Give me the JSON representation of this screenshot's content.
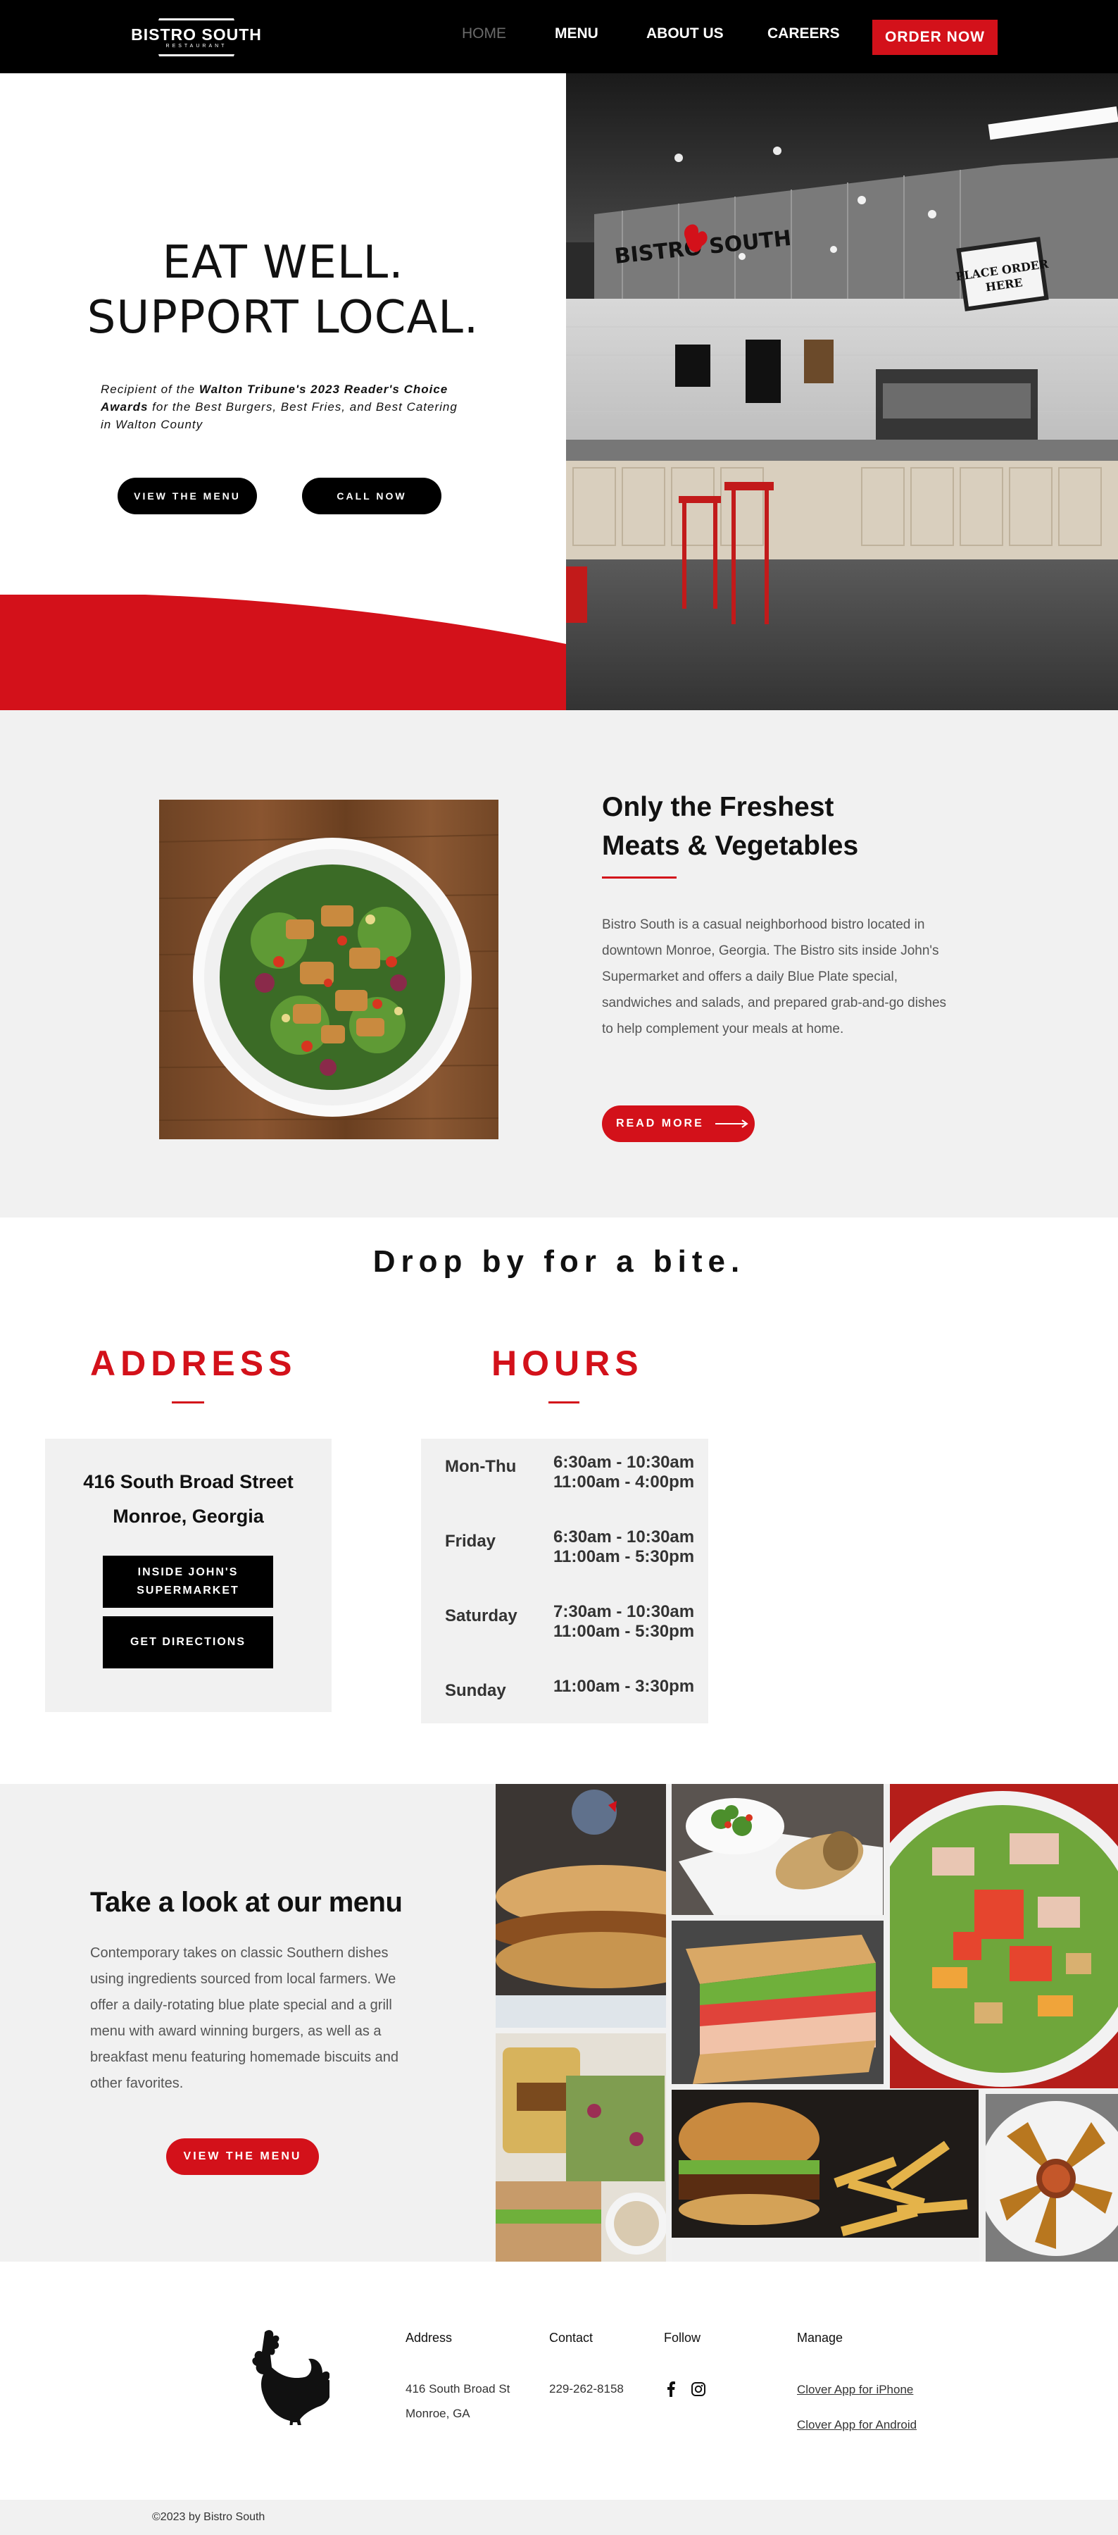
{
  "nav": {
    "logo_text": "BISTRO SOUTH",
    "logo_sub": "RESTAURANT",
    "links": [
      "HOME",
      "MENU",
      "ABOUT US",
      "CAREERS"
    ],
    "order_label": "ORDER NOW"
  },
  "hero": {
    "title_line1": "EAT WELL.",
    "title_line2": "SUPPORT LOCAL.",
    "award_prefix": "Recipient of the ",
    "award_bold": "Walton Tribune's 2023 Reader's Choice Awards",
    "award_suffix": " for the Best Burgers, Best Fries, and Best Catering in Walton County",
    "btn_menu": "VIEW THE MENU",
    "btn_call": "CALL NOW",
    "photo_sign_brand": "BISTRO SOUTH",
    "photo_sign_order": "PLACE ORDER HERE"
  },
  "fresh": {
    "title_line1": "Only the Freshest",
    "title_line2": "Meats & Vegetables",
    "body": "Bistro South is a casual neighborhood bistro located in downtown Monroe, Georgia. The Bistro sits inside John's Supermarket and offers a daily Blue Plate special, sandwiches and salads, and prepared grab-and-go dishes to help complement your meals at home.",
    "btn": "READ MORE"
  },
  "visit": {
    "title": "Drop by for a bite.",
    "address_head": "ADDRESS",
    "hours_head": "HOURS",
    "street": "416 South Broad Street",
    "city": "Monroe, Georgia",
    "btn_inside": "INSIDE JOHN'S SUPERMARKET",
    "btn_directions": "GET DIRECTIONS",
    "hours": [
      {
        "day": "Mon-Thu",
        "t1": "6:30am - 10:30am",
        "t2": "11:00am - 4:00pm"
      },
      {
        "day": "Friday",
        "t1": "6:30am - 10:30am",
        "t2": "11:00am - 5:30pm"
      },
      {
        "day": "Saturday",
        "t1": "7:30am - 10:30am",
        "t2": "11:00am - 5:30pm"
      },
      {
        "day": "Sunday",
        "t1": "11:00am - 3:30pm",
        "t2": ""
      }
    ]
  },
  "menu": {
    "title": "Take a look at our menu",
    "body": "Contemporary takes on classic Southern dishes using ingredients sourced from local farmers. We offer a daily-rotating blue plate special and a grill menu with award winning burgers, as well as a breakfast menu featuring homemade biscuits and other favorites.",
    "btn": "VIEW THE MENU"
  },
  "footer": {
    "address_head": "Address",
    "address_line1": "416 South Broad St",
    "address_line2": "Monroe, GA",
    "contact_head": "Contact",
    "phone": "229-262-8158",
    "follow_head": "Follow",
    "manage_head": "Manage",
    "link_iphone": "Clover App for iPhone",
    "link_android": "Clover App for Android",
    "copyright": "©2023 by Bistro South"
  },
  "colors": {
    "accent": "#d3111a",
    "nav_bg": "#000000",
    "section_bg": "#f1f1f1"
  }
}
